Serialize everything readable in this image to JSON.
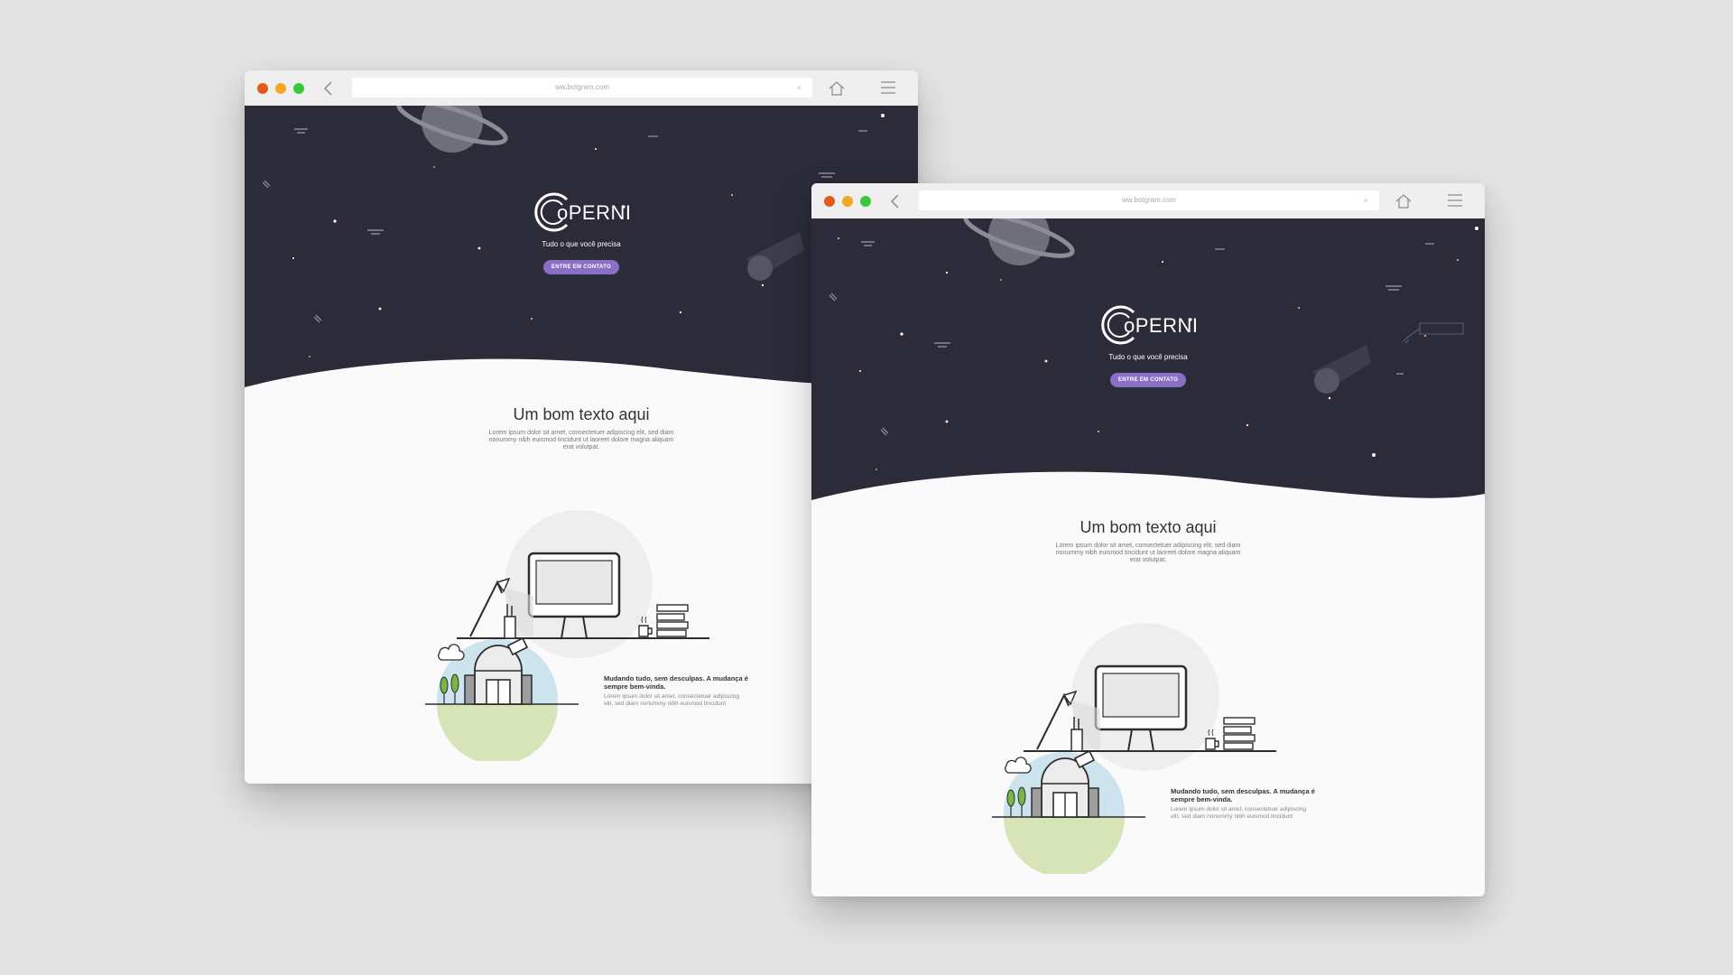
{
  "browser": {
    "url": "ww.botgram.com",
    "clear_symbol": "×"
  },
  "hero": {
    "logo_text": "oPERNI",
    "tagline": "Tudo o que você precisa",
    "cta_label": "ENTRE EM CONTATO"
  },
  "intro": {
    "title": "Um bom texto aqui",
    "body": "Lorem ipsum dolor sit amet, consectetuer adipiscing elit, sed diam nonummy nibh euismod tincidunt ut laoreet dolore magna aliquam erat volutpat."
  },
  "feature": {
    "heading": "Mudando tudo, sem desculpas. A mudança é sempre bem-vinda.",
    "body": "Lorem ipsum dolor sit amet, consectetuer adipiscing elit, sed diam nonummy nibh euismod tincidunt"
  },
  "colors": {
    "page_background": "#e4e4e4",
    "hero_background": "#2b2b3a",
    "cta_purple": "#8b6fc6",
    "dot_red": "#e25a1c",
    "dot_yellow": "#f5a623",
    "dot_green": "#3cc83c"
  },
  "icons": [
    "back-arrow-icon",
    "home-icon",
    "hamburger-menu-icon",
    "close-icon"
  ],
  "illustrations": [
    "planet-illustration",
    "comet-illustration",
    "desk-illustration",
    "observatory-illustration"
  ]
}
